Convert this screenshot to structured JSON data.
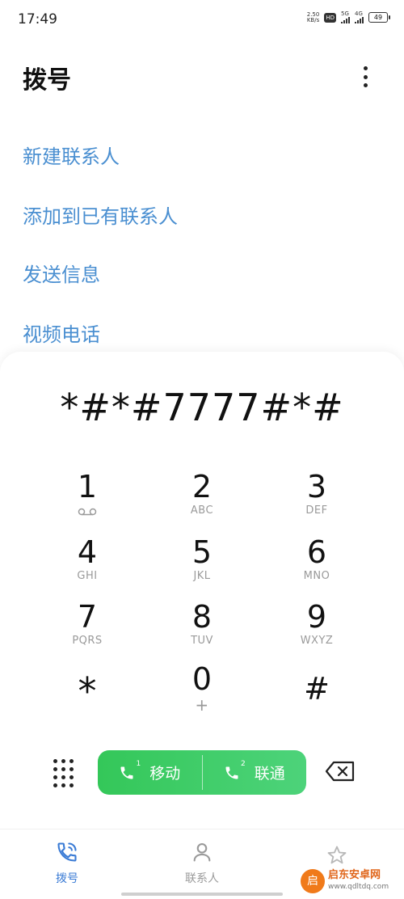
{
  "status": {
    "time": "17:49",
    "speed_value": "2.50",
    "speed_unit": "KB/s",
    "hd": "HD",
    "sim1_net": "5G",
    "sim2_net": "4G",
    "battery": "49"
  },
  "header": {
    "title": "拨号"
  },
  "actions": [
    "新建联系人",
    "添加到已有联系人",
    "发送信息",
    "视频电话"
  ],
  "dial_number": "*#*#7777#*#",
  "keys": [
    {
      "digit": "1",
      "letters": ""
    },
    {
      "digit": "2",
      "letters": "ABC"
    },
    {
      "digit": "3",
      "letters": "DEF"
    },
    {
      "digit": "4",
      "letters": "GHI"
    },
    {
      "digit": "5",
      "letters": "JKL"
    },
    {
      "digit": "6",
      "letters": "MNO"
    },
    {
      "digit": "7",
      "letters": "PQRS"
    },
    {
      "digit": "8",
      "letters": "TUV"
    },
    {
      "digit": "9",
      "letters": "WXYZ"
    },
    {
      "digit": "*",
      "letters": ""
    },
    {
      "digit": "0",
      "letters": "+"
    },
    {
      "digit": "#",
      "letters": ""
    }
  ],
  "call": {
    "sim1_label": "移动",
    "sim1_index": "1",
    "sim2_label": "联通",
    "sim2_index": "2"
  },
  "nav": [
    {
      "label": "拨号",
      "icon": "phone-icon",
      "active": true
    },
    {
      "label": "联系人",
      "icon": "contact-icon",
      "active": false
    }
  ],
  "watermark": {
    "name": "启东安卓网",
    "url": "www.qdltdq.com",
    "logo_char": "启"
  },
  "colors": {
    "accent": "#4a8fd1",
    "call_green": "#34c759",
    "nav_active": "#3a7bd5",
    "nav_inactive": "#9a9a9a"
  }
}
